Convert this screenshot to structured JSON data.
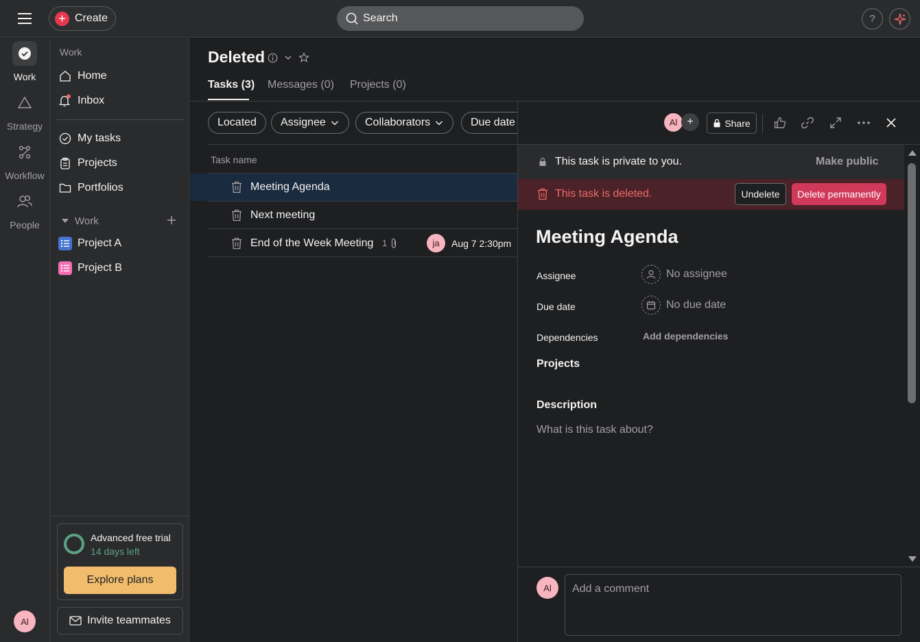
{
  "topbar": {
    "create_label": "Create",
    "search_placeholder": "Search",
    "help_label": "?"
  },
  "rail": {
    "items": [
      {
        "label": "Work",
        "icon": "check-circle-icon"
      },
      {
        "label": "Strategy",
        "icon": "triangle-icon"
      },
      {
        "label": "Workflow",
        "icon": "workflow-icon"
      },
      {
        "label": "People",
        "icon": "people-icon"
      }
    ],
    "avatar_initials": "Al"
  },
  "sidebar": {
    "work_heading": "Work",
    "home": "Home",
    "inbox": "Inbox",
    "my_tasks": "My tasks",
    "projects": "Projects",
    "portfolios": "Portfolios",
    "work_section": "Work",
    "project_items": [
      {
        "name": "Project A",
        "color": "#4573d2"
      },
      {
        "name": "Project B",
        "color": "#f26fb2"
      }
    ],
    "trial": {
      "title": "Advanced free trial",
      "days_left": "14 days left",
      "explore": "Explore plans"
    },
    "invite": "Invite teammates"
  },
  "main": {
    "title": "Deleted",
    "tabs": [
      "Tasks (3)",
      "Messages (0)",
      "Projects (0)"
    ],
    "filters": [
      "Located",
      "Assignee",
      "Collaborators",
      "Due date"
    ],
    "column_header": "Task name",
    "tasks": [
      {
        "name": "Meeting Agenda"
      },
      {
        "name": "Next meeting"
      },
      {
        "name": "End of the Week Meeting",
        "attachments": "1",
        "assignee_initials": "ja",
        "due": "Aug 7 2:30pm"
      }
    ]
  },
  "detail": {
    "avatar_initials": "Al",
    "share": "Share",
    "private_text": "This task is private to you.",
    "make_public": "Make public",
    "deleted_text": "This task is deleted.",
    "undelete": "Undelete",
    "delete_permanently": "Delete permanently",
    "task_title": "Meeting Agenda",
    "fields": {
      "assignee_label": "Assignee",
      "assignee_value": "No assignee",
      "due_label": "Due date",
      "due_value": "No due date",
      "dependencies_label": "Dependencies",
      "dependencies_value": "Add dependencies"
    },
    "projects_label": "Projects",
    "description_label": "Description",
    "description_placeholder": "What is this task about?",
    "comment_avatar": "Al",
    "comment_placeholder": "Add a comment"
  },
  "colors": {
    "accent_red": "#e8384f",
    "trial_green": "#5da283",
    "explore_yellow": "#f1bd6c",
    "delete_pink": "#d1395a",
    "avatar_pink": "#f7b5c0"
  }
}
